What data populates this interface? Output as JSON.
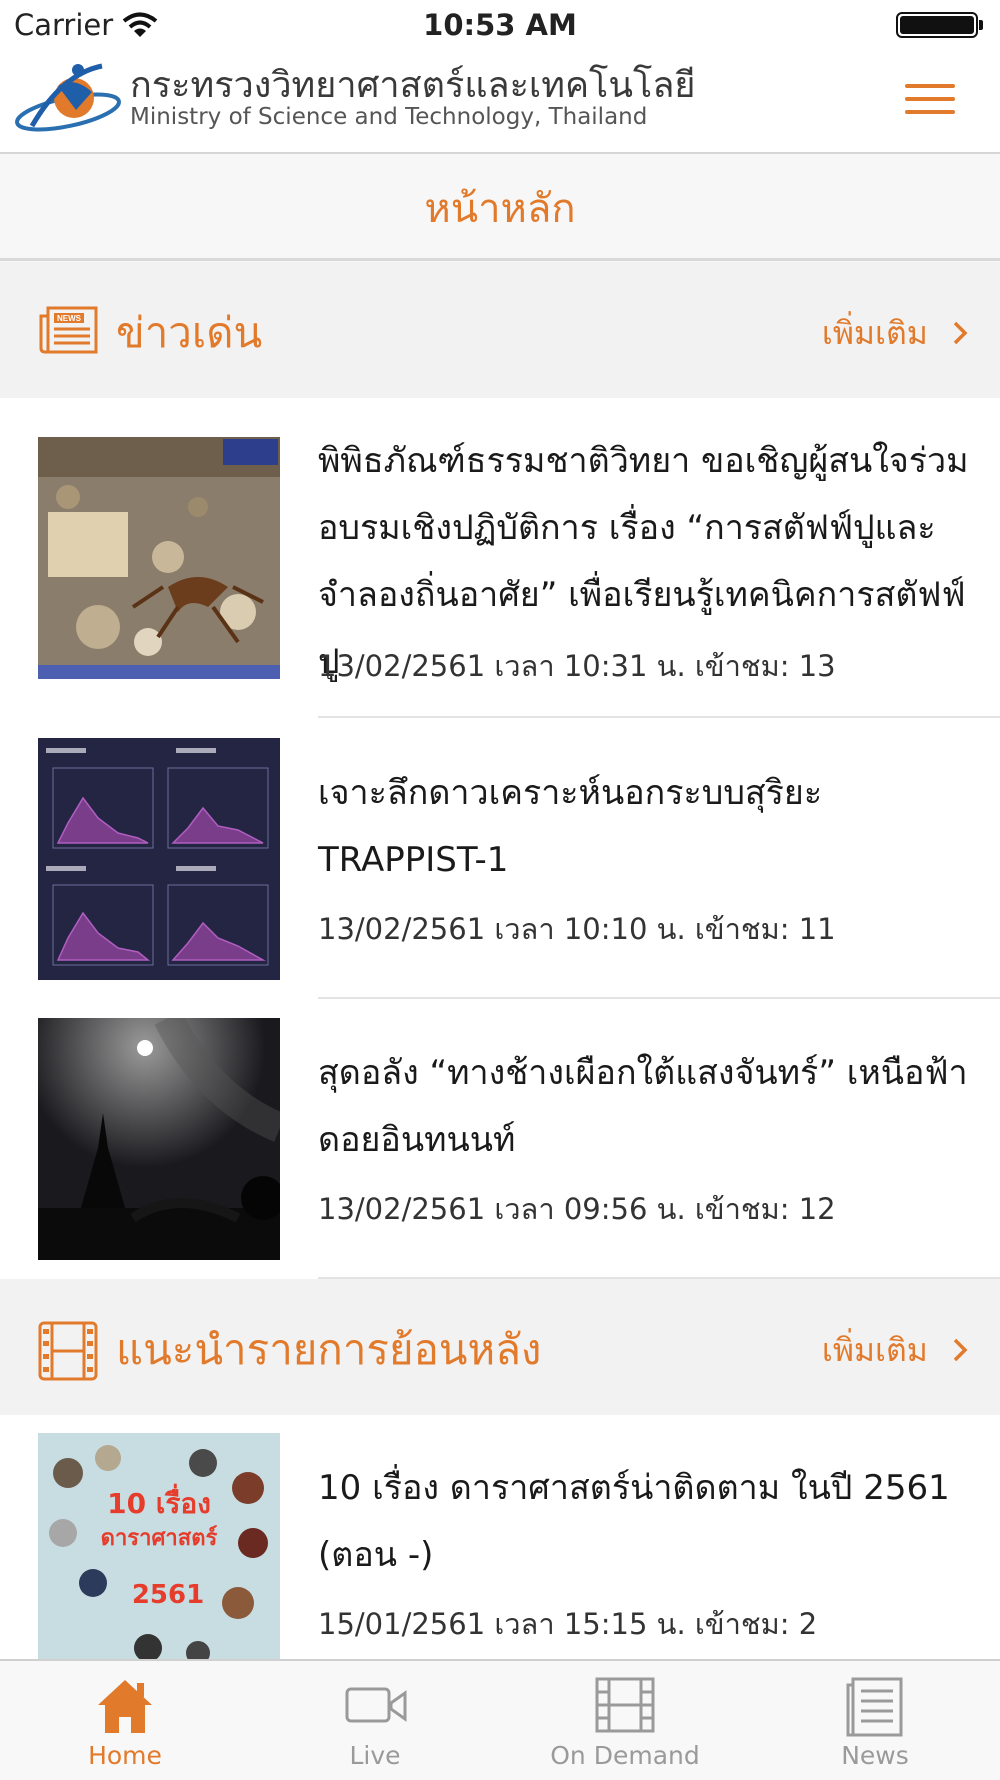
{
  "status_bar": {
    "carrier": "Carrier",
    "time": "10:53 AM"
  },
  "header": {
    "title_th": "กระทรวงวิทยาศาสตร์และเทคโนโลยี",
    "title_en": "Ministry of Science and Technology, Thailand"
  },
  "page": {
    "title": "หน้าหลัก"
  },
  "news_section": {
    "title": "ข่าวเด่น",
    "more_label": "เพิ่มเติม",
    "items": [
      {
        "title": "พิพิธภัณฑ์ธรรมชาติวิทยา ขอเชิญผู้สนใจร่วม อบรมเชิงปฏิบัติการ เรื่อง “การสตัฟฟ์ปูและจำลองถิ่นอาศัย” เพื่อเรียนรู้เทคนิคการสตัฟฟ์ปู",
        "meta": "13/02/2561 เวลา 10:31 น. เข้าชม: 13"
      },
      {
        "title": "เจาะลึกดาวเคราะห์นอกระบบสุริยะ TRAPPIST-1",
        "meta": "13/02/2561 เวลา 10:10 น. เข้าชม: 11"
      },
      {
        "title": "สุดอลัง “ทางช้างเผือกใต้แสงจันทร์” เหนือฟ้าดอยอินทนนท์",
        "meta": "13/02/2561 เวลา 09:56 น. เข้าชม: 12"
      }
    ]
  },
  "replay_section": {
    "title": "แนะนำรายการย้อนหลัง",
    "more_label": "เพิ่มเติม",
    "items": [
      {
        "title": "10 เรื่อง ดาราศาสตร์น่าติดตาม ในปี 2561 (ตอน -)",
        "meta": "15/01/2561 เวลา 15:15 น. เข้าชม: 2",
        "thumb_text_1": "10 เรื่อง",
        "thumb_text_2": "ดาราศาสตร์",
        "thumb_text_3": "2561"
      }
    ]
  },
  "tab_bar": {
    "tabs": [
      {
        "label": "Home",
        "icon": "home-icon",
        "active": true
      },
      {
        "label": "Live",
        "icon": "video-camera-icon",
        "active": false
      },
      {
        "label": "On Demand",
        "icon": "film-icon",
        "active": false
      },
      {
        "label": "News",
        "icon": "newspaper-icon",
        "active": false
      }
    ]
  },
  "colors": {
    "accent": "#e27a2c",
    "inactive": "#9a9a9a"
  }
}
